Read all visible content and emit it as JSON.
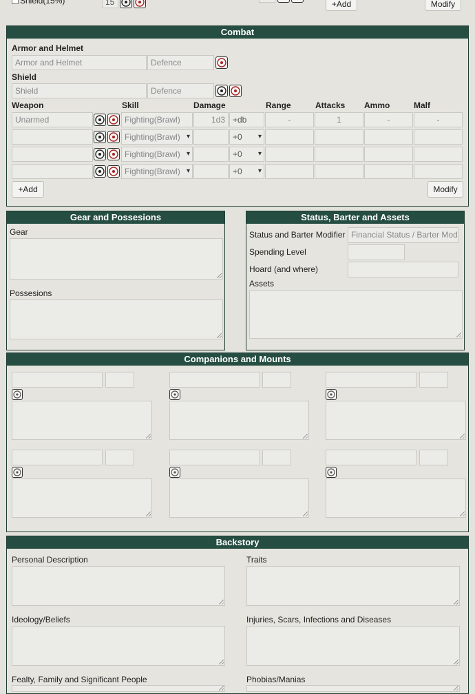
{
  "top": {
    "shield_label": "Shield(15%)",
    "shield_value": "15",
    "add_label": "+Add",
    "modify_label": "Modify"
  },
  "combat": {
    "title": "Combat",
    "armor_heading": "Armor and Helmet",
    "armor_placeholder": "Armor and Helmet",
    "armor_defence_placeholder": "Defence",
    "shield_heading": "Shield",
    "shield_placeholder": "Shield",
    "shield_defence_placeholder": "Defence",
    "columns": {
      "weapon": "Weapon",
      "skill": "Skill",
      "damage": "Damage",
      "range": "Range",
      "attacks": "Attacks",
      "ammo": "Ammo",
      "malf": "Malf"
    },
    "rows": [
      {
        "weapon": "Unarmed",
        "skill": "Fighting(Brawl)",
        "damage": "1d3",
        "bonus": "+db",
        "range": "-",
        "attacks": "1",
        "ammo": "-",
        "malf": "-"
      },
      {
        "weapon": "",
        "skill": "Fighting(Brawl)",
        "damage": "",
        "bonus": "+0",
        "range": "",
        "attacks": "",
        "ammo": "",
        "malf": ""
      },
      {
        "weapon": "",
        "skill": "Fighting(Brawl)",
        "damage": "",
        "bonus": "+0",
        "range": "",
        "attacks": "",
        "ammo": "",
        "malf": ""
      },
      {
        "weapon": "",
        "skill": "Fighting(Brawl)",
        "damage": "",
        "bonus": "+0",
        "range": "",
        "attacks": "",
        "ammo": "",
        "malf": ""
      }
    ],
    "add_label": "+Add",
    "modify_label": "Modify"
  },
  "gear": {
    "title": "Gear and Possesions",
    "gear_label": "Gear",
    "possessions_label": "Possesions"
  },
  "status": {
    "title": "Status, Barter and Assets",
    "status_label": "Status and Barter Modifier",
    "status_placeholder": "Financial Status / Barter Modifier",
    "spending_label": "Spending Level",
    "hoard_label": "Hoard (and where)",
    "assets_label": "Assets"
  },
  "companions": {
    "title": "Companions and Mounts"
  },
  "backstory": {
    "title": "Backstory",
    "personal_description": "Personal Description",
    "traits": "Traits",
    "ideology": "Ideology/Beliefs",
    "injuries": "Injuries, Scars, Infections and Diseases",
    "fealty": "Fealty, Family and Significant People",
    "phobias": "Phobias/Manias"
  }
}
